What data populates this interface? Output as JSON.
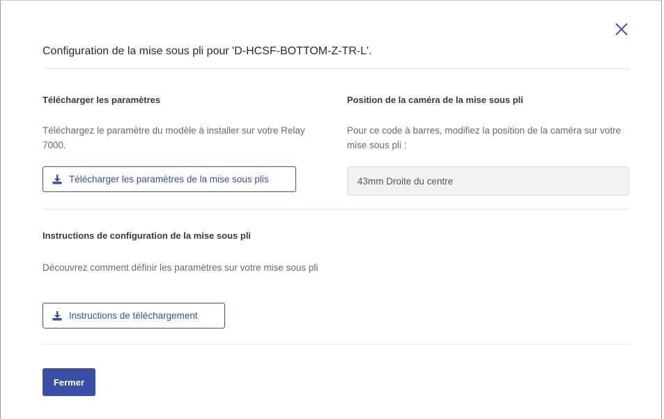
{
  "dialog": {
    "title": "Configuration de la mise sous pli pour 'D-HCSF-BOTTOM-Z-TR-L'.",
    "close_icon": "close-icon",
    "close_label": "Fermer"
  },
  "download_settings": {
    "heading": "Télécharger les paramètres",
    "description": "Téléchargez le paramètre du modèle à installer sur votre Relay 7000.",
    "button_label": "Télécharger les paramètres de la mise sous plis",
    "button_icon": "download-icon"
  },
  "camera_position": {
    "heading": "Position de la caméra de la mise sous pli",
    "description": "Pour ce code à barres, modifiez la position de la caméra sur votre mise sous pli :",
    "value": "43mm Droite du centre"
  },
  "instructions": {
    "heading": "Instructions de configuration de la mise sous pli",
    "description": "Découvrez comment définir les paramètres sur votre mise sous pli",
    "button_label": "Instructions de téléchargement",
    "button_icon": "download-icon"
  },
  "colors": {
    "accent": "#3b4ea6",
    "field_background": "#f2f2f2",
    "divider": "#e6e6e6"
  }
}
